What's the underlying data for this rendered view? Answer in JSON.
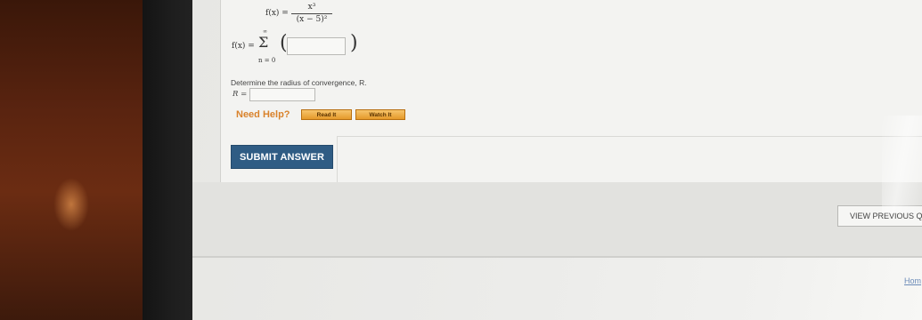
{
  "math": {
    "fx_label": "f(x) =",
    "numerator": "x³",
    "denominator": "(x − 5)²",
    "series_label": "f(x) =",
    "sigma": "Σ",
    "sum_upper": "∞",
    "sum_lower": "n = 0",
    "paren_open": "(",
    "paren_close": ")",
    "series_term_value": ""
  },
  "question": {
    "text": "Determine the radius of convergence, R.",
    "r_label": "R =",
    "r_value": ""
  },
  "help": {
    "label": "Need Help?",
    "read_it": "Read It",
    "watch_it": "Watch It"
  },
  "actions": {
    "submit": "SUBMIT ANSWER",
    "view_previous": "VIEW PREVIOUS Q",
    "home": "Hom"
  },
  "colors": {
    "submit_bg": "#2f5c84",
    "help_text": "#d9822b",
    "help_button": "#f0b04a"
  }
}
